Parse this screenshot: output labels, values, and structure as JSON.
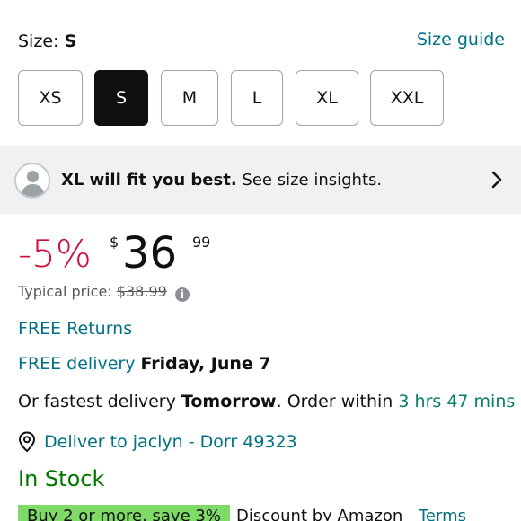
{
  "size": {
    "label_prefix": "Size:",
    "selected": "S",
    "guide_link": "Size guide",
    "options": [
      "XS",
      "S",
      "M",
      "L",
      "XL",
      "XXL"
    ]
  },
  "insight": {
    "bold": "XL will fit you best.",
    "rest": "See size insights."
  },
  "price": {
    "discount": "-5%",
    "symbol": "$",
    "whole": "36",
    "fraction": "99",
    "typical_label": "Typical price:",
    "typical_value": "$38.99"
  },
  "returns": {
    "label": "FREE Returns"
  },
  "delivery": {
    "free_label": "FREE delivery",
    "date": "Friday, June 7",
    "fastest_prefix": "Or fastest delivery",
    "fastest_day": "Tomorrow",
    "order_within": ". Order within",
    "time_left": "3 hrs 47 mins",
    "deliver_to": "Deliver to jaclyn - Dorr 49323"
  },
  "stock": {
    "status": "In Stock"
  },
  "promo": {
    "badge": "Buy 2 or more, save 3%",
    "text": "Discount by Amazon",
    "terms": "Terms"
  },
  "colors": {
    "link": "#007185",
    "discount": "#cc0c39",
    "in_stock": "#007600",
    "promo_badge": "#7fda68",
    "selected_swatch": "#0f1111"
  },
  "icons": [
    "person-avatar-icon",
    "chevron-right-icon",
    "info-icon",
    "location-pin-icon"
  ]
}
